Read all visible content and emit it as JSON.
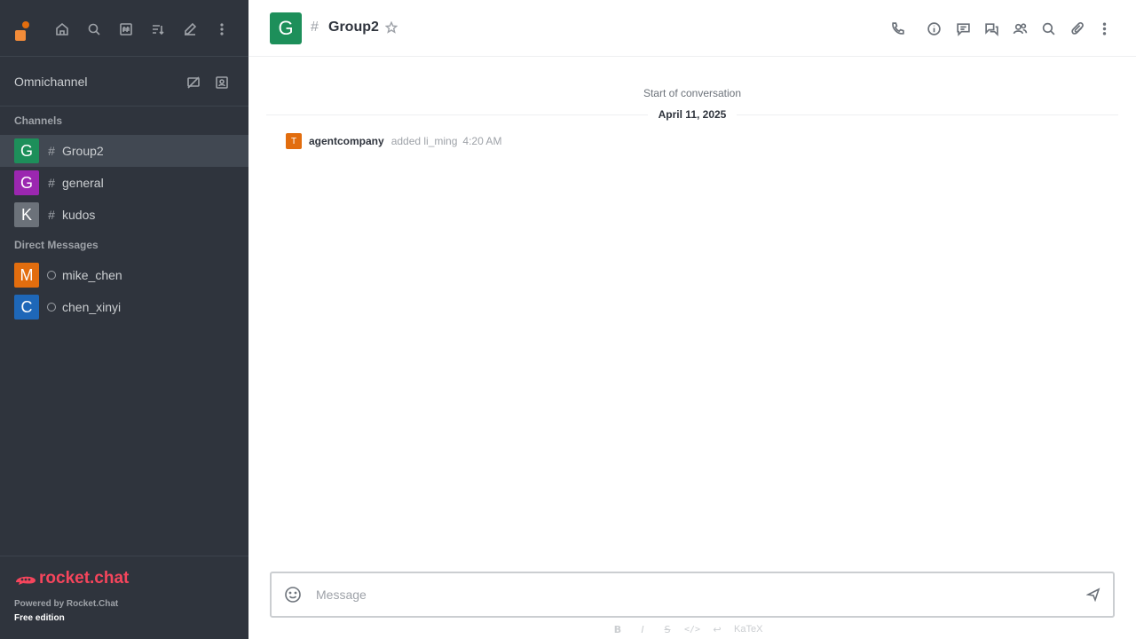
{
  "sidebar": {
    "omnichannel_label": "Omnichannel",
    "channels_title": "Channels",
    "channels": [
      {
        "avatar_letter": "G",
        "name": "Group2",
        "color": "#1d8f5a"
      },
      {
        "avatar_letter": "G",
        "name": "general",
        "color": "#9b27b0"
      },
      {
        "avatar_letter": "K",
        "name": "kudos",
        "color": "#6c727a"
      }
    ],
    "dm_title": "Direct Messages",
    "dms": [
      {
        "avatar_letter": "M",
        "name": "mike_chen",
        "color": "#e26d0e"
      },
      {
        "avatar_letter": "C",
        "name": "chen_xinyi",
        "color": "#1e67b8"
      }
    ],
    "footer": {
      "logo_text": "rocket.chat",
      "powered_by": "Powered by Rocket.Chat",
      "edition": "Free edition"
    }
  },
  "header": {
    "avatar_letter": "G",
    "hash": "#",
    "room_name": "Group2"
  },
  "conversation": {
    "start_text": "Start of conversation",
    "date_divider": "April 11, 2025",
    "system_message": {
      "avatar_letter": "T",
      "user": "agentcompany",
      "action": "added li_ming",
      "time": "4:20 AM"
    }
  },
  "composer": {
    "placeholder": "Message",
    "value": "",
    "format": {
      "bold": "B",
      "italic": "I",
      "strike": "S",
      "code": "</>",
      "link_glyph": "↩",
      "link_text": "KaTeX"
    }
  },
  "colors": {
    "sidebar_bg": "#2f343d",
    "accent": "#f5455c",
    "active_room": "#414852"
  }
}
